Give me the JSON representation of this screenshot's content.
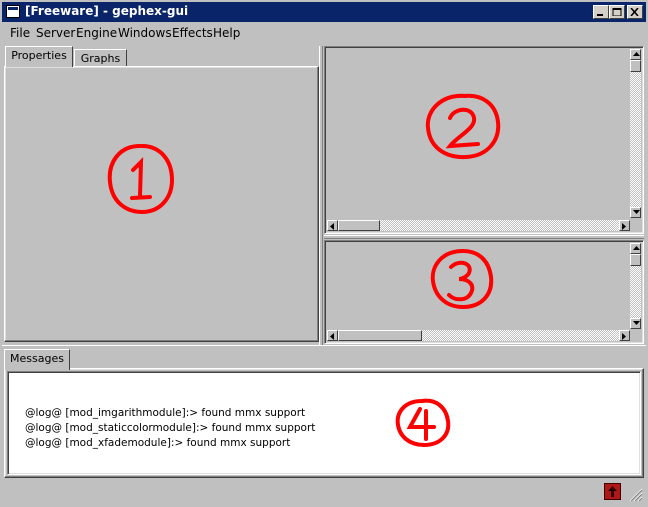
{
  "window": {
    "title": "[Freeware] - gephex-gui"
  },
  "caption_buttons": {
    "minimize": "minimize",
    "maximize": "maximize",
    "close": "close"
  },
  "menubar": {
    "items": [
      "File",
      "Server",
      "Engine",
      "Windows",
      "Effects",
      "Help"
    ]
  },
  "left_panel": {
    "tabs": [
      {
        "label": "Properties",
        "active": true
      },
      {
        "label": "Graphs",
        "active": false
      }
    ]
  },
  "messages": {
    "tab_label": "Messages",
    "lines": [
      "@log@ [mod_imgarithmodule]:> found mmx support",
      "@log@ [mod_staticcolormodule]:> found mmx support",
      "@log@ [mod_xfademodule]:> found mmx support"
    ]
  },
  "annotations": [
    "1",
    "2",
    "3",
    "4"
  ],
  "colors": {
    "title_bar": "#0a246a",
    "annotation": "#ff0000",
    "window_bg": "#c0c0c0",
    "status_icon": "#b01818"
  },
  "icons": {
    "app": "window-icon",
    "status": "tray-icon",
    "grip": "resize-grip-icon"
  }
}
